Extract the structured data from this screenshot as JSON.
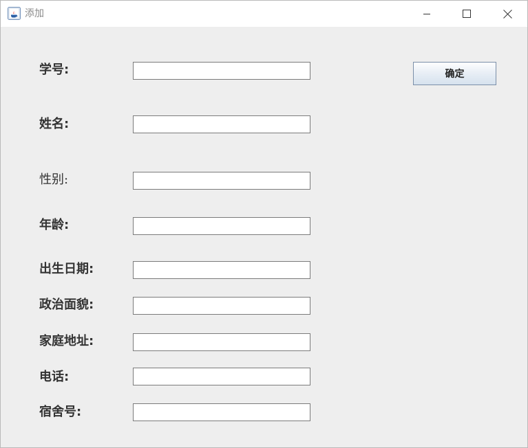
{
  "window": {
    "title": "添加",
    "app_icon": "java-icon",
    "controls": [
      "minimize-icon",
      "maximize-icon",
      "close-icon"
    ]
  },
  "form": {
    "fields": [
      {
        "label": "学号:",
        "value": ""
      },
      {
        "label": "姓名:",
        "value": ""
      },
      {
        "label": "性别:",
        "value": ""
      },
      {
        "label": "年龄:",
        "value": ""
      },
      {
        "label": "出生日期:",
        "value": ""
      },
      {
        "label": "政治面貌:",
        "value": ""
      },
      {
        "label": "家庭地址:",
        "value": ""
      },
      {
        "label": "电话:",
        "value": ""
      },
      {
        "label": "宿舍号:",
        "value": ""
      }
    ],
    "confirm_label": "确定"
  }
}
